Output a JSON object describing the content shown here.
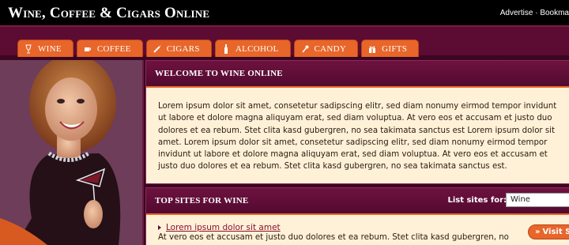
{
  "header": {
    "title": "Wine, Coffee & Cigars Online",
    "links": [
      "Advertise",
      "·",
      "Bookma"
    ]
  },
  "nav": {
    "tabs": [
      {
        "label": "WINE",
        "icon": "wine-glass-icon"
      },
      {
        "label": "COFFEE",
        "icon": "coffee-cup-icon"
      },
      {
        "label": "CIGARS",
        "icon": "cigar-icon"
      },
      {
        "label": "ALCOHOL",
        "icon": "bottle-icon"
      },
      {
        "label": "CANDY",
        "icon": "candy-icon"
      },
      {
        "label": "GIFTS",
        "icon": "gift-icon"
      }
    ]
  },
  "welcome": {
    "heading": "WELCOME TO WINE ONLINE",
    "text": "Lorem ipsum dolor sit amet, consetetur sadipscing elitr, sed diam nonumy eirmod tempor invidunt ut labore et dolore magna aliquyam erat, sed diam voluptua. At vero eos et accusam et justo duo dolores et ea rebum. Stet clita kasd gubergren, no sea takimata sanctus est Lorem ipsum dolor sit amet. Lorem ipsum dolor sit amet, consetetur sadipscing elitr, sed diam nonumy eirmod tempor invidunt ut labore et dolore magna aliquyam erat, sed diam voluptua. At vero eos et accusam et justo duo dolores et ea rebum. Stet clita kasd gubergren, no sea takimata sanctus est."
  },
  "top_sites": {
    "heading": "TOP SITES FOR WINE",
    "list_label": "List sites for:",
    "select_value": "Wine",
    "items": [
      {
        "title": "Lorem ipsum dolor sit amet",
        "description": "At vero eos et accusam et justo duo dolores et ea rebum. Stet clita kasd gubergren, no",
        "button": "Visit Si"
      }
    ]
  },
  "colors": {
    "header_bg": "#000000",
    "nav_bg": "#5c0b32",
    "tab_orange": "#e8662a",
    "content_bg": "#fff1d8",
    "box_head": "#5c0b32"
  }
}
